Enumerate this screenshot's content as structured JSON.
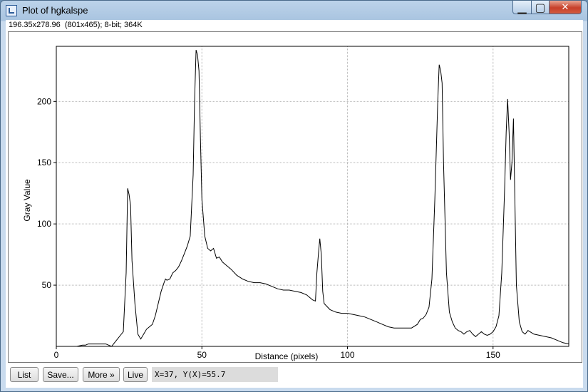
{
  "window": {
    "title": "Plot of hgkalspe",
    "icon": "imagej-plot-icon",
    "controls": {
      "minimize": "▁",
      "maximize": "▢",
      "close": "✕"
    }
  },
  "info_bar": "196.35x278.96  (801x465); 8-bit; 364K",
  "plot": {
    "xlabel": "Distance (pixels)",
    "ylabel": "Gray Value"
  },
  "chart_data": {
    "type": "line",
    "xlabel": "Distance (pixels)",
    "ylabel": "Gray Value",
    "xlim": [
      0,
      176
    ],
    "ylim": [
      0,
      245
    ],
    "x_ticks": [
      0,
      50,
      100,
      150
    ],
    "y_ticks": [
      50,
      100,
      150,
      200
    ],
    "grid": true,
    "series": [
      {
        "color": "#000000",
        "points": [
          [
            0,
            0
          ],
          [
            4,
            0
          ],
          [
            7,
            0
          ],
          [
            9,
            1
          ],
          [
            10,
            1
          ],
          [
            11,
            2
          ],
          [
            13,
            2
          ],
          [
            15,
            2
          ],
          [
            17,
            2
          ],
          [
            18,
            1
          ],
          [
            19,
            0
          ],
          [
            20,
            3
          ],
          [
            21,
            6
          ],
          [
            22,
            9
          ],
          [
            23,
            12
          ],
          [
            24,
            60
          ],
          [
            24.5,
            129
          ],
          [
            25,
            124
          ],
          [
            25.5,
            115
          ],
          [
            26,
            70
          ],
          [
            27,
            35
          ],
          [
            28,
            10
          ],
          [
            29,
            6
          ],
          [
            30,
            10
          ],
          [
            31,
            14
          ],
          [
            32,
            16
          ],
          [
            33,
            18
          ],
          [
            34,
            25
          ],
          [
            35,
            35
          ],
          [
            36,
            45
          ],
          [
            37,
            52
          ],
          [
            37.5,
            55
          ],
          [
            38,
            54
          ],
          [
            39,
            55
          ],
          [
            40,
            60
          ],
          [
            41,
            62
          ],
          [
            42,
            65
          ],
          [
            43,
            70
          ],
          [
            44,
            76
          ],
          [
            45,
            82
          ],
          [
            46,
            90
          ],
          [
            47,
            140
          ],
          [
            47.5,
            200
          ],
          [
            48,
            242
          ],
          [
            48.5,
            238
          ],
          [
            49,
            225
          ],
          [
            49.5,
            170
          ],
          [
            50,
            120
          ],
          [
            51,
            90
          ],
          [
            52,
            80
          ],
          [
            53,
            78
          ],
          [
            54,
            80
          ],
          [
            55,
            72
          ],
          [
            56,
            73
          ],
          [
            57,
            69
          ],
          [
            58,
            67
          ],
          [
            60,
            63
          ],
          [
            62,
            58
          ],
          [
            64,
            55
          ],
          [
            66,
            53
          ],
          [
            68,
            52
          ],
          [
            70,
            52
          ],
          [
            72,
            51
          ],
          [
            74,
            49
          ],
          [
            76,
            47
          ],
          [
            78,
            46
          ],
          [
            80,
            46
          ],
          [
            82,
            45
          ],
          [
            84,
            44
          ],
          [
            86,
            42
          ],
          [
            87,
            40
          ],
          [
            88,
            38
          ],
          [
            89,
            37
          ],
          [
            89.5,
            60
          ],
          [
            90,
            75
          ],
          [
            90.5,
            88
          ],
          [
            91,
            75
          ],
          [
            91.5,
            45
          ],
          [
            92,
            35
          ],
          [
            94,
            30
          ],
          [
            96,
            28
          ],
          [
            98,
            27
          ],
          [
            100,
            27
          ],
          [
            102,
            26
          ],
          [
            104,
            25
          ],
          [
            106,
            24
          ],
          [
            108,
            22
          ],
          [
            110,
            20
          ],
          [
            112,
            18
          ],
          [
            114,
            16
          ],
          [
            116,
            15
          ],
          [
            118,
            15
          ],
          [
            120,
            15
          ],
          [
            122,
            15
          ],
          [
            124,
            18
          ],
          [
            125,
            22
          ],
          [
            126,
            23
          ],
          [
            127,
            26
          ],
          [
            128,
            32
          ],
          [
            129,
            55
          ],
          [
            130,
            120
          ],
          [
            131,
            200
          ],
          [
            131.5,
            230
          ],
          [
            132,
            225
          ],
          [
            132.5,
            215
          ],
          [
            133,
            150
          ],
          [
            134,
            60
          ],
          [
            135,
            28
          ],
          [
            136,
            20
          ],
          [
            137,
            15
          ],
          [
            138,
            13
          ],
          [
            139,
            12
          ],
          [
            140,
            10
          ],
          [
            141,
            12
          ],
          [
            142,
            13
          ],
          [
            143,
            10
          ],
          [
            144,
            8
          ],
          [
            145,
            10
          ],
          [
            146,
            12
          ],
          [
            147,
            10
          ],
          [
            148,
            9
          ],
          [
            149,
            10
          ],
          [
            150,
            12
          ],
          [
            151,
            16
          ],
          [
            152,
            25
          ],
          [
            153,
            60
          ],
          [
            154,
            130
          ],
          [
            154.5,
            175
          ],
          [
            155,
            202
          ],
          [
            155.5,
            175
          ],
          [
            156,
            136
          ],
          [
            156.5,
            150
          ],
          [
            157,
            186
          ],
          [
            157.5,
            120
          ],
          [
            158,
            50
          ],
          [
            159,
            20
          ],
          [
            160,
            12
          ],
          [
            161,
            10
          ],
          [
            162,
            13
          ],
          [
            164,
            10
          ],
          [
            166,
            9
          ],
          [
            168,
            8
          ],
          [
            170,
            7
          ],
          [
            172,
            5
          ],
          [
            174,
            3
          ],
          [
            176,
            2
          ]
        ]
      }
    ]
  },
  "toolbar": {
    "list": "List",
    "save": "Save...",
    "more": "More »",
    "live": "Live",
    "coords": "X=37, Y(X)=55.7"
  }
}
